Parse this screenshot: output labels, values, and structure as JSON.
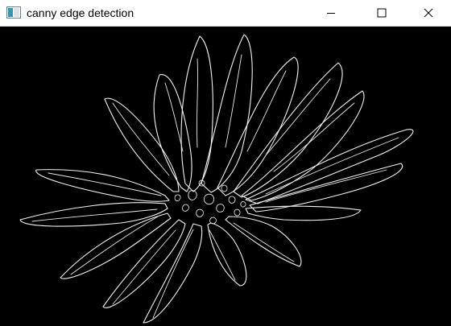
{
  "window": {
    "title": "canny edge detection",
    "icon": "opencv-window-icon",
    "controls": {
      "minimize_icon": "minimize-icon",
      "maximize_icon": "maximize-icon",
      "close_icon": "close-icon"
    }
  },
  "image": {
    "description_icon": "canny-edge-image",
    "background_color": "#000000",
    "edge_color": "#ffffff"
  }
}
